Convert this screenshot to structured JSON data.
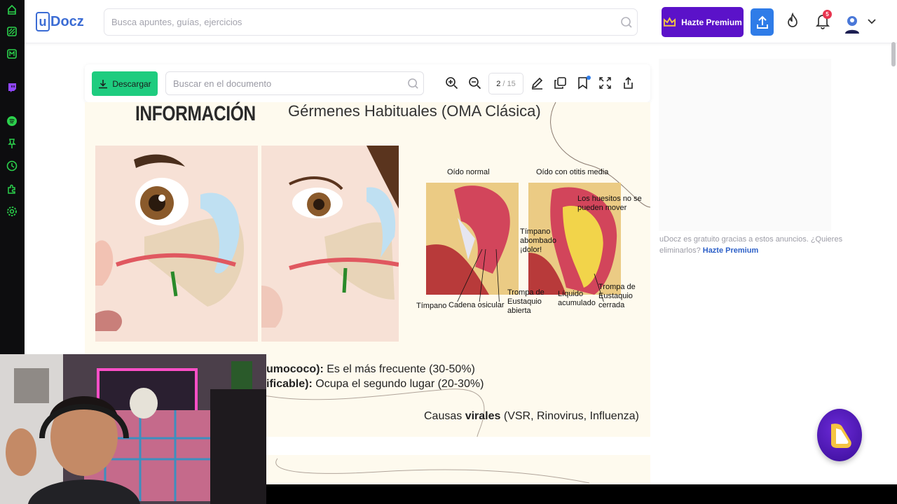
{
  "topbar": {
    "logo_u": "u",
    "logo_text": "Docz",
    "search_placeholder": "Busca apuntes, guías, ejercicios",
    "premium_label": "Hazte Premium",
    "notifications_count": "5"
  },
  "doc_toolbar": {
    "download_label": "Descargar",
    "search_placeholder": "Buscar en el documento",
    "page_current": "2",
    "page_total": "/ 15"
  },
  "page": {
    "title": "INFORMACIÓN",
    "subtitle": "Gérmenes Habituales (OMA Clásica)",
    "diagram": {
      "normal_label": "Oído normal",
      "otitis_label": "Oído con otitis media",
      "huesitos": "Los huesitos no se pueden mover",
      "timpano_abombado": "Tímpano abombado ¡dolor!",
      "timpano": "Tímpano",
      "cadena": "Cadena osicular",
      "trompa_abierta": "Trompa de Eustaquio abierta",
      "liquido": "Líquido acumulado",
      "trompa_cerrada": "Trompa de Eustaquio cerrada"
    },
    "bullet1_bold": "umococo):",
    "bullet1_text": " Es el más frecuente (30-50%)",
    "bullet2_bold": "ificable):",
    "bullet2_text": " Ocupa el segundo lugar (20-30%)",
    "viral_prefix": "Causas ",
    "viral_bold": "virales",
    "viral_suffix": " (VSR, Rinovirus, Influenza)"
  },
  "ad": {
    "text": "uDocz es gratuito gracias a estos anuncios. ¿Quieres eliminarlos? ",
    "link": "Hazte Premium"
  },
  "colors": {
    "brand_blue": "#3b6cd4",
    "premium_purple": "#5b12c9",
    "download_green": "#1ecc7f",
    "dock_green": "#2bd14c"
  }
}
